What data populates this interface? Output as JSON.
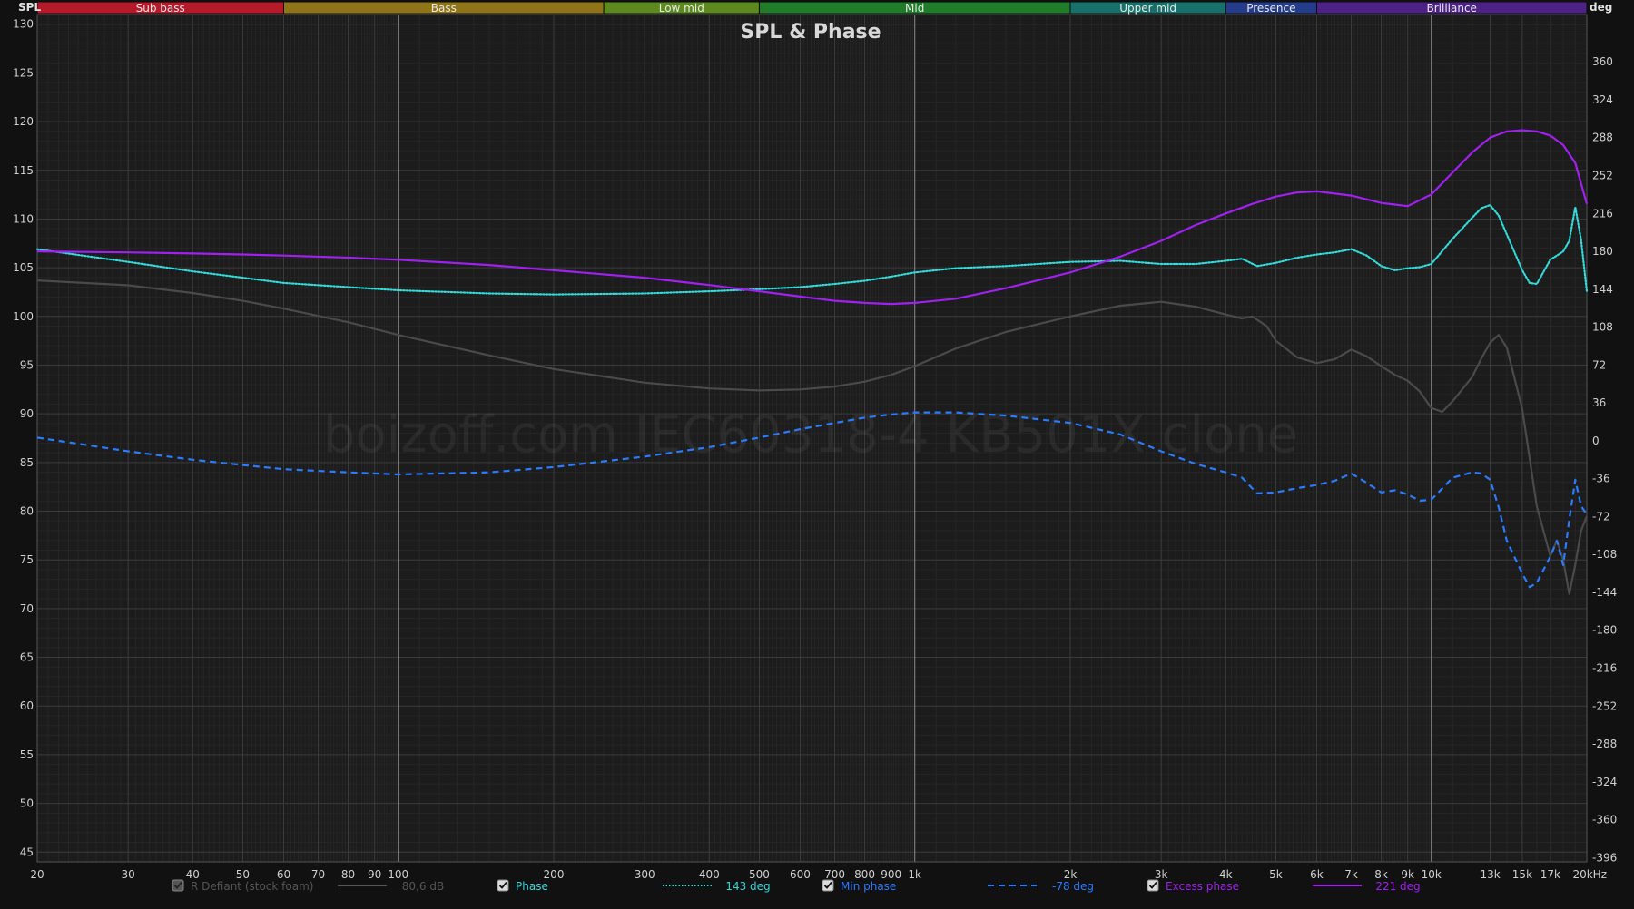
{
  "chart_data": {
    "type": "line",
    "title": "SPL & Phase",
    "watermark": "boizoff.com IEC60318-4 KB501X clone",
    "left_axis_unit": "SPL",
    "right_axis_unit": "deg",
    "x_scale": "log",
    "xlim": [
      20,
      20000
    ],
    "ylim_left": [
      44,
      131
    ],
    "ylim_right": [
      -400,
      405
    ],
    "x_ticks": [
      {
        "v": 20,
        "label": "20"
      },
      {
        "v": 30,
        "label": "30"
      },
      {
        "v": 40,
        "label": "40"
      },
      {
        "v": 50,
        "label": "50"
      },
      {
        "v": 60,
        "label": "60"
      },
      {
        "v": 70,
        "label": "70"
      },
      {
        "v": 80,
        "label": "80"
      },
      {
        "v": 90,
        "label": "90"
      },
      {
        "v": 100,
        "label": "100"
      },
      {
        "v": 200,
        "label": "200"
      },
      {
        "v": 300,
        "label": "300"
      },
      {
        "v": 400,
        "label": "400"
      },
      {
        "v": 500,
        "label": "500"
      },
      {
        "v": 600,
        "label": "600"
      },
      {
        "v": 700,
        "label": "700"
      },
      {
        "v": 800,
        "label": "800"
      },
      {
        "v": 900,
        "label": "900"
      },
      {
        "v": 1000,
        "label": "1k"
      },
      {
        "v": 2000,
        "label": "2k"
      },
      {
        "v": 3000,
        "label": "3k"
      },
      {
        "v": 4000,
        "label": "4k"
      },
      {
        "v": 5000,
        "label": "5k"
      },
      {
        "v": 6000,
        "label": "6k"
      },
      {
        "v": 7000,
        "label": "7k"
      },
      {
        "v": 8000,
        "label": "8k"
      },
      {
        "v": 9000,
        "label": "9k"
      },
      {
        "v": 10000,
        "label": "10k"
      },
      {
        "v": 13000,
        "label": "13k"
      },
      {
        "v": 15000,
        "label": "15k"
      },
      {
        "v": 17000,
        "label": "17k"
      },
      {
        "v": 20000,
        "label": "20kHz"
      }
    ],
    "y_ticks_left": [
      130,
      125,
      120,
      115,
      110,
      105,
      100,
      95,
      90,
      85,
      80,
      75,
      70,
      65,
      60,
      55,
      50,
      45
    ],
    "y_ticks_right": [
      360,
      324,
      288,
      252,
      216,
      180,
      144,
      108,
      72,
      36,
      0,
      -36,
      -72,
      -108,
      -144,
      -180,
      -216,
      -252,
      -288,
      -324,
      -360,
      -396
    ],
    "bands": [
      {
        "label": "Sub bass",
        "from": 20,
        "to": 60,
        "color": "#b5192a"
      },
      {
        "label": "Bass",
        "from": 60,
        "to": 250,
        "color": "#8f7518"
      },
      {
        "label": "Low mid",
        "from": 250,
        "to": 500,
        "color": "#5c8a1f"
      },
      {
        "label": "Mid",
        "from": 500,
        "to": 2000,
        "color": "#1f7d2a"
      },
      {
        "label": "Upper mid",
        "from": 2000,
        "to": 4000,
        "color": "#17706a"
      },
      {
        "label": "Presence",
        "from": 4000,
        "to": 6000,
        "color": "#243c8a"
      },
      {
        "label": "Brilliance",
        "from": 6000,
        "to": 20000,
        "color": "#4d2287"
      }
    ],
    "series": [
      {
        "name": "R Defiant (stock foam)",
        "axis": "left",
        "color": "#4a4a4a",
        "style": "solid",
        "legend_value": "80,6 dB",
        "enabled": false,
        "points": [
          [
            20,
            103.7
          ],
          [
            30,
            103.2
          ],
          [
            40,
            102.4
          ],
          [
            50,
            101.6
          ],
          [
            60,
            100.8
          ],
          [
            80,
            99.4
          ],
          [
            100,
            98.1
          ],
          [
            150,
            96.0
          ],
          [
            200,
            94.6
          ],
          [
            300,
            93.2
          ],
          [
            400,
            92.6
          ],
          [
            500,
            92.4
          ],
          [
            600,
            92.5
          ],
          [
            700,
            92.8
          ],
          [
            800,
            93.3
          ],
          [
            900,
            94.0
          ],
          [
            1000,
            94.9
          ],
          [
            1200,
            96.7
          ],
          [
            1500,
            98.4
          ],
          [
            2000,
            100.0
          ],
          [
            2500,
            101.1
          ],
          [
            3000,
            101.5
          ],
          [
            3500,
            101.0
          ],
          [
            4000,
            100.2
          ],
          [
            4300,
            99.8
          ],
          [
            4500,
            100.0
          ],
          [
            4800,
            99.0
          ],
          [
            5000,
            97.5
          ],
          [
            5500,
            95.8
          ],
          [
            6000,
            95.2
          ],
          [
            6500,
            95.6
          ],
          [
            7000,
            96.6
          ],
          [
            7500,
            95.9
          ],
          [
            8000,
            94.9
          ],
          [
            8500,
            94.0
          ],
          [
            9000,
            93.4
          ],
          [
            9500,
            92.3
          ],
          [
            10000,
            90.6
          ],
          [
            10500,
            90.2
          ],
          [
            11000,
            91.3
          ],
          [
            12000,
            93.8
          ],
          [
            12500,
            95.7
          ],
          [
            13000,
            97.3
          ],
          [
            13500,
            98.1
          ],
          [
            14000,
            96.8
          ],
          [
            15000,
            90.5
          ],
          [
            16000,
            80.5
          ],
          [
            17000,
            75.4
          ],
          [
            17500,
            77.0
          ],
          [
            18000,
            75.0
          ],
          [
            18500,
            71.5
          ],
          [
            19000,
            74.5
          ],
          [
            19500,
            78.0
          ],
          [
            20000,
            79.5
          ]
        ]
      },
      {
        "name": "Phase",
        "axis": "right",
        "color": "#34d9d9",
        "style": "dotted",
        "legend_value": "143 deg",
        "enabled": true,
        "points": [
          [
            20,
            182
          ],
          [
            30,
            170
          ],
          [
            40,
            161
          ],
          [
            50,
            155
          ],
          [
            60,
            150
          ],
          [
            80,
            146
          ],
          [
            100,
            143
          ],
          [
            150,
            140
          ],
          [
            200,
            139
          ],
          [
            300,
            140
          ],
          [
            400,
            142
          ],
          [
            500,
            144
          ],
          [
            600,
            146
          ],
          [
            700,
            149
          ],
          [
            800,
            152
          ],
          [
            900,
            156
          ],
          [
            1000,
            160
          ],
          [
            1200,
            164
          ],
          [
            1500,
            166
          ],
          [
            2000,
            170
          ],
          [
            2500,
            171
          ],
          [
            3000,
            168
          ],
          [
            3500,
            168
          ],
          [
            4000,
            171
          ],
          [
            4300,
            173
          ],
          [
            4600,
            166
          ],
          [
            5000,
            169
          ],
          [
            5500,
            174
          ],
          [
            6000,
            177
          ],
          [
            6500,
            179
          ],
          [
            7000,
            182
          ],
          [
            7500,
            176
          ],
          [
            8000,
            166
          ],
          [
            8500,
            162
          ],
          [
            9000,
            164
          ],
          [
            9500,
            165
          ],
          [
            10000,
            168
          ],
          [
            11000,
            192
          ],
          [
            12000,
            212
          ],
          [
            12500,
            221
          ],
          [
            13000,
            224
          ],
          [
            13500,
            214
          ],
          [
            14000,
            196
          ],
          [
            15000,
            162
          ],
          [
            15500,
            150
          ],
          [
            16000,
            149
          ],
          [
            17000,
            172
          ],
          [
            17500,
            176
          ],
          [
            18000,
            180
          ],
          [
            18500,
            190
          ],
          [
            19000,
            222
          ],
          [
            19500,
            191
          ],
          [
            20000,
            142
          ]
        ]
      },
      {
        "name": "Min phase",
        "axis": "right",
        "color": "#2a7bff",
        "style": "dashed",
        "legend_value": "-78 deg",
        "enabled": true,
        "points": [
          [
            20,
            3
          ],
          [
            30,
            -10
          ],
          [
            40,
            -18
          ],
          [
            50,
            -23
          ],
          [
            60,
            -27
          ],
          [
            80,
            -30
          ],
          [
            100,
            -32
          ],
          [
            150,
            -30
          ],
          [
            200,
            -25
          ],
          [
            300,
            -15
          ],
          [
            400,
            -6
          ],
          [
            500,
            3
          ],
          [
            600,
            11
          ],
          [
            700,
            17
          ],
          [
            800,
            22
          ],
          [
            900,
            25
          ],
          [
            1000,
            27
          ],
          [
            1200,
            27
          ],
          [
            1500,
            24
          ],
          [
            2000,
            17
          ],
          [
            2500,
            6
          ],
          [
            3000,
            -10
          ],
          [
            3500,
            -22
          ],
          [
            4000,
            -30
          ],
          [
            4300,
            -35
          ],
          [
            4600,
            -50
          ],
          [
            5000,
            -49
          ],
          [
            5500,
            -45
          ],
          [
            6000,
            -42
          ],
          [
            6500,
            -38
          ],
          [
            7000,
            -31
          ],
          [
            7500,
            -40
          ],
          [
            8000,
            -49
          ],
          [
            8500,
            -47
          ],
          [
            9000,
            -51
          ],
          [
            9500,
            -57
          ],
          [
            10000,
            -56
          ],
          [
            11000,
            -35
          ],
          [
            12000,
            -30
          ],
          [
            12500,
            -31
          ],
          [
            13000,
            -37
          ],
          [
            13500,
            -63
          ],
          [
            14000,
            -95
          ],
          [
            15000,
            -126
          ],
          [
            15500,
            -139
          ],
          [
            16000,
            -135
          ],
          [
            17000,
            -110
          ],
          [
            17500,
            -95
          ],
          [
            18000,
            -118
          ],
          [
            18500,
            -75
          ],
          [
            19000,
            -37
          ],
          [
            19500,
            -62
          ],
          [
            20000,
            -70
          ]
        ]
      },
      {
        "name": "Excess phase",
        "axis": "right",
        "color": "#a020f0",
        "style": "solid",
        "legend_value": "221 deg",
        "enabled": true,
        "points": [
          [
            20,
            180
          ],
          [
            30,
            179
          ],
          [
            40,
            178
          ],
          [
            50,
            177
          ],
          [
            60,
            176
          ],
          [
            80,
            174
          ],
          [
            100,
            172
          ],
          [
            150,
            167
          ],
          [
            200,
            162
          ],
          [
            300,
            155
          ],
          [
            400,
            148
          ],
          [
            500,
            142
          ],
          [
            600,
            137
          ],
          [
            700,
            133
          ],
          [
            800,
            131
          ],
          [
            900,
            130
          ],
          [
            1000,
            131
          ],
          [
            1200,
            135
          ],
          [
            1500,
            145
          ],
          [
            2000,
            160
          ],
          [
            2500,
            175
          ],
          [
            3000,
            190
          ],
          [
            3500,
            205
          ],
          [
            4000,
            216
          ],
          [
            4500,
            225
          ],
          [
            5000,
            232
          ],
          [
            5500,
            236
          ],
          [
            6000,
            237
          ],
          [
            7000,
            233
          ],
          [
            8000,
            226
          ],
          [
            9000,
            223
          ],
          [
            10000,
            234
          ],
          [
            11000,
            255
          ],
          [
            12000,
            274
          ],
          [
            13000,
            288
          ],
          [
            14000,
            294
          ],
          [
            15000,
            295
          ],
          [
            16000,
            294
          ],
          [
            17000,
            290
          ],
          [
            18000,
            281
          ],
          [
            19000,
            264
          ],
          [
            20000,
            225
          ]
        ]
      }
    ]
  }
}
